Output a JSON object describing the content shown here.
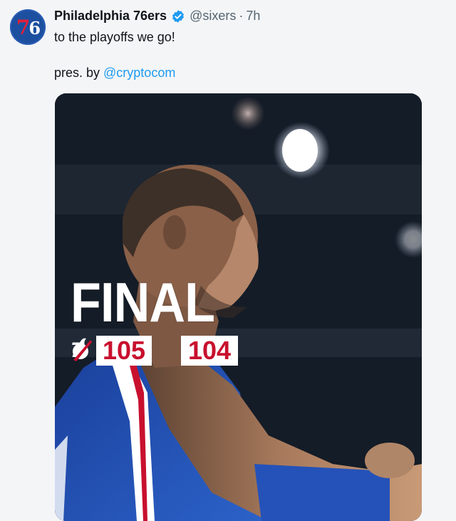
{
  "tweet": {
    "avatar_text_a": "7",
    "avatar_text_b": "6",
    "display_name": "Philadelphia 76ers",
    "handle": "@sixers",
    "separator": "·",
    "time": "7h",
    "text": "to the playoffs we go!",
    "sponsor_prefix": "pres. by ",
    "sponsor_mention": "@cryptocom"
  },
  "graphic": {
    "final_label": "FINAL",
    "home_team_logo": "76ers-logo",
    "home_score": "105",
    "away_team_logo": "heat-logo",
    "away_score": "104"
  },
  "colors": {
    "verified": "#1d9bf0",
    "mention": "#1d9bf0",
    "score_text": "#c8102e",
    "sixers_blue": "#1d4fa0"
  }
}
